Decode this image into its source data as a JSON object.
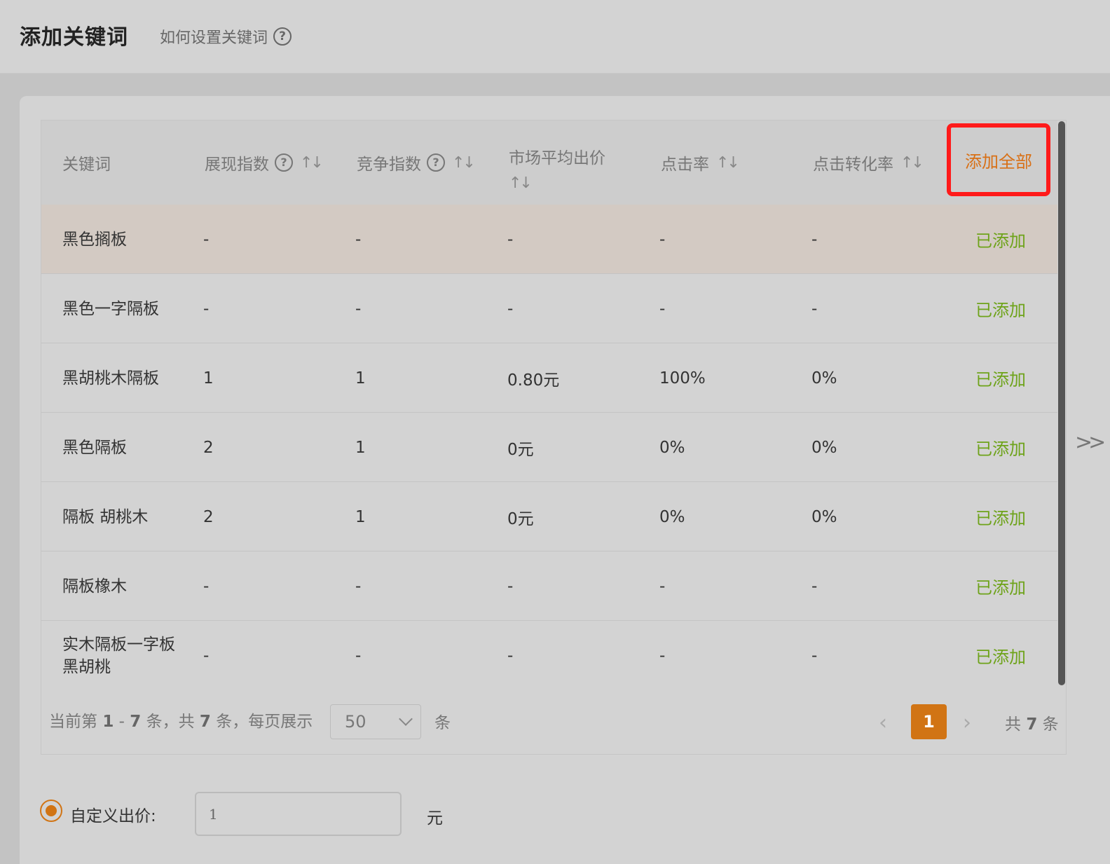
{
  "header": {
    "title": "添加关键词",
    "help_text": "如何设置关键词"
  },
  "table": {
    "columns": {
      "keyword": "关键词",
      "impression": "展现指数",
      "competition": "竞争指数",
      "avg_bid": "市场平均出价",
      "ctr": "点击率",
      "cvr": "点击转化率",
      "add_all": "添加全部"
    },
    "rows": [
      {
        "keyword": "黑色搁板",
        "impression": "-",
        "competition": "-",
        "avg_bid": "-",
        "ctr": "-",
        "cvr": "-",
        "status": "已添加"
      },
      {
        "keyword": "黑色一字隔板",
        "impression": "-",
        "competition": "-",
        "avg_bid": "-",
        "ctr": "-",
        "cvr": "-",
        "status": "已添加"
      },
      {
        "keyword": "黑胡桃木隔板",
        "impression": "1",
        "competition": "1",
        "avg_bid": "0.80元",
        "ctr": "100%",
        "cvr": "0%",
        "status": "已添加"
      },
      {
        "keyword": "黑色隔板",
        "impression": "2",
        "competition": "1",
        "avg_bid": "0元",
        "ctr": "0%",
        "cvr": "0%",
        "status": "已添加"
      },
      {
        "keyword": "隔板 胡桃木",
        "impression": "2",
        "competition": "1",
        "avg_bid": "0元",
        "ctr": "0%",
        "cvr": "0%",
        "status": "已添加"
      },
      {
        "keyword": "隔板橡木",
        "impression": "-",
        "competition": "-",
        "avg_bid": "-",
        "ctr": "-",
        "cvr": "-",
        "status": "已添加"
      },
      {
        "keyword": "实木隔板一字板黑胡桃",
        "impression": "-",
        "competition": "-",
        "avg_bid": "-",
        "ctr": "-",
        "cvr": "-",
        "status": "已添加"
      }
    ]
  },
  "pagination": {
    "prefix": "当前第 ",
    "range_start": "1",
    "range_sep": " - ",
    "range_end": "7",
    "mid": " 条，共 ",
    "total": "7",
    "suffix": " 条，每页展示",
    "page_size": "50",
    "unit": "条",
    "current_page": "1",
    "total_prefix": "共 ",
    "total_count": "7",
    "total_suffix": " 条"
  },
  "bid": {
    "label": "自定义出价:",
    "value": "1",
    "unit": "元"
  },
  "colors": {
    "accent": "#d17414",
    "added": "#6ea31a",
    "highlight_border": "#ff1a1a"
  }
}
